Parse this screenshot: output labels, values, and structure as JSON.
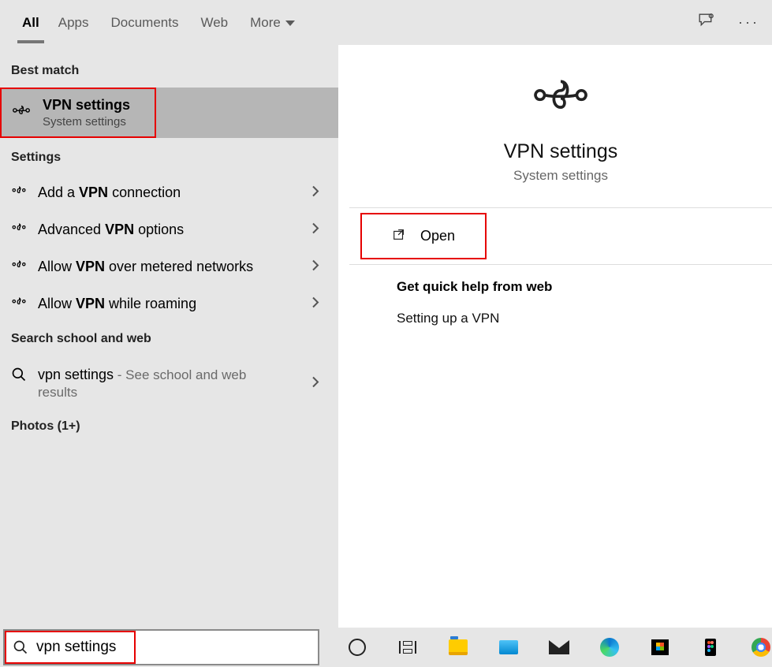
{
  "tabs": {
    "all": "All",
    "apps": "Apps",
    "documents": "Documents",
    "web": "Web",
    "more": "More"
  },
  "sections": {
    "best_match": "Best match",
    "settings": "Settings",
    "search_school_web": "Search school and web",
    "photos": "Photos (1+)"
  },
  "best_match": {
    "title": "VPN settings",
    "subtitle": "System settings"
  },
  "settings_items": [
    {
      "pre": "Add a ",
      "bold": "VPN",
      "post": " connection"
    },
    {
      "pre": "Advanced ",
      "bold": "VPN",
      "post": " options"
    },
    {
      "pre": "Allow ",
      "bold": "VPN",
      "post": " over metered networks"
    },
    {
      "pre": "Allow ",
      "bold": "VPN",
      "post": " while roaming"
    }
  ],
  "web_search": {
    "query": "vpn settings",
    "hint_pre": " - ",
    "hint": "See school and web results"
  },
  "preview": {
    "title": "VPN settings",
    "subtitle": "System settings",
    "open": "Open",
    "help_header": "Get quick help from web",
    "help_link": "Setting up a VPN"
  },
  "search": {
    "value": "vpn settings"
  }
}
